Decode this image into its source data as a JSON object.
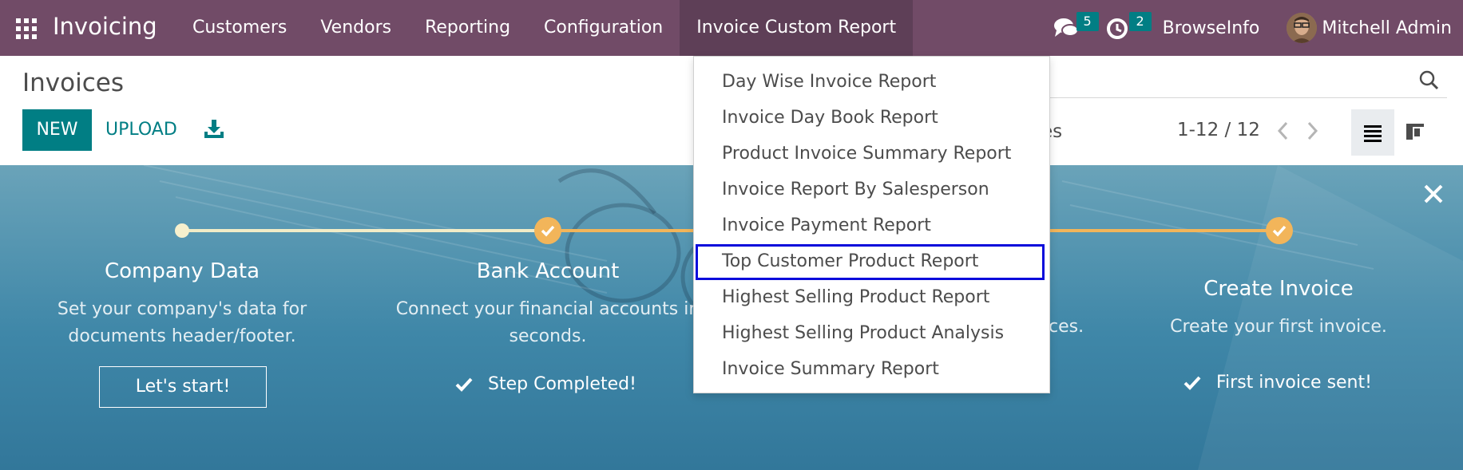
{
  "navbar": {
    "app_name": "Invoicing",
    "menu": [
      "Customers",
      "Vendors",
      "Reporting",
      "Configuration",
      "Invoice Custom Report"
    ],
    "messages_count": "5",
    "activities_count": "2",
    "company": "BrowseInfo",
    "user": "Mitchell Admin",
    "bg_color": "#714b67"
  },
  "control": {
    "title": "Invoices",
    "new_label": "NEW",
    "upload_label": "UPLOAD",
    "filter_partial": "tes",
    "pager": "1-12 / 12"
  },
  "dropdown": {
    "items": [
      "Day Wise Invoice Report",
      "Invoice Day Book Report",
      "Product Invoice Summary Report",
      "Invoice Report By Salesperson",
      "Invoice Payment Report",
      "Top Customer Product Report",
      "Highest Selling Product Report",
      "Highest Selling Product Analysis",
      "Invoice Summary Report"
    ],
    "highlighted": "Top Customer Product Report"
  },
  "banner": {
    "steps": [
      {
        "title": "Company Data",
        "desc1": "Set your company's data for",
        "desc2": "documents header/footer.",
        "action": "Let's start!"
      },
      {
        "title": "Bank Account",
        "desc1": "Connect your financial accounts in",
        "desc2": "seconds.",
        "action": "Step Completed!"
      },
      {
        "desc_partial": "ces."
      },
      {
        "title": "Create Invoice",
        "desc1": "Create your first invoice.",
        "action": "First invoice sent!"
      }
    ]
  }
}
